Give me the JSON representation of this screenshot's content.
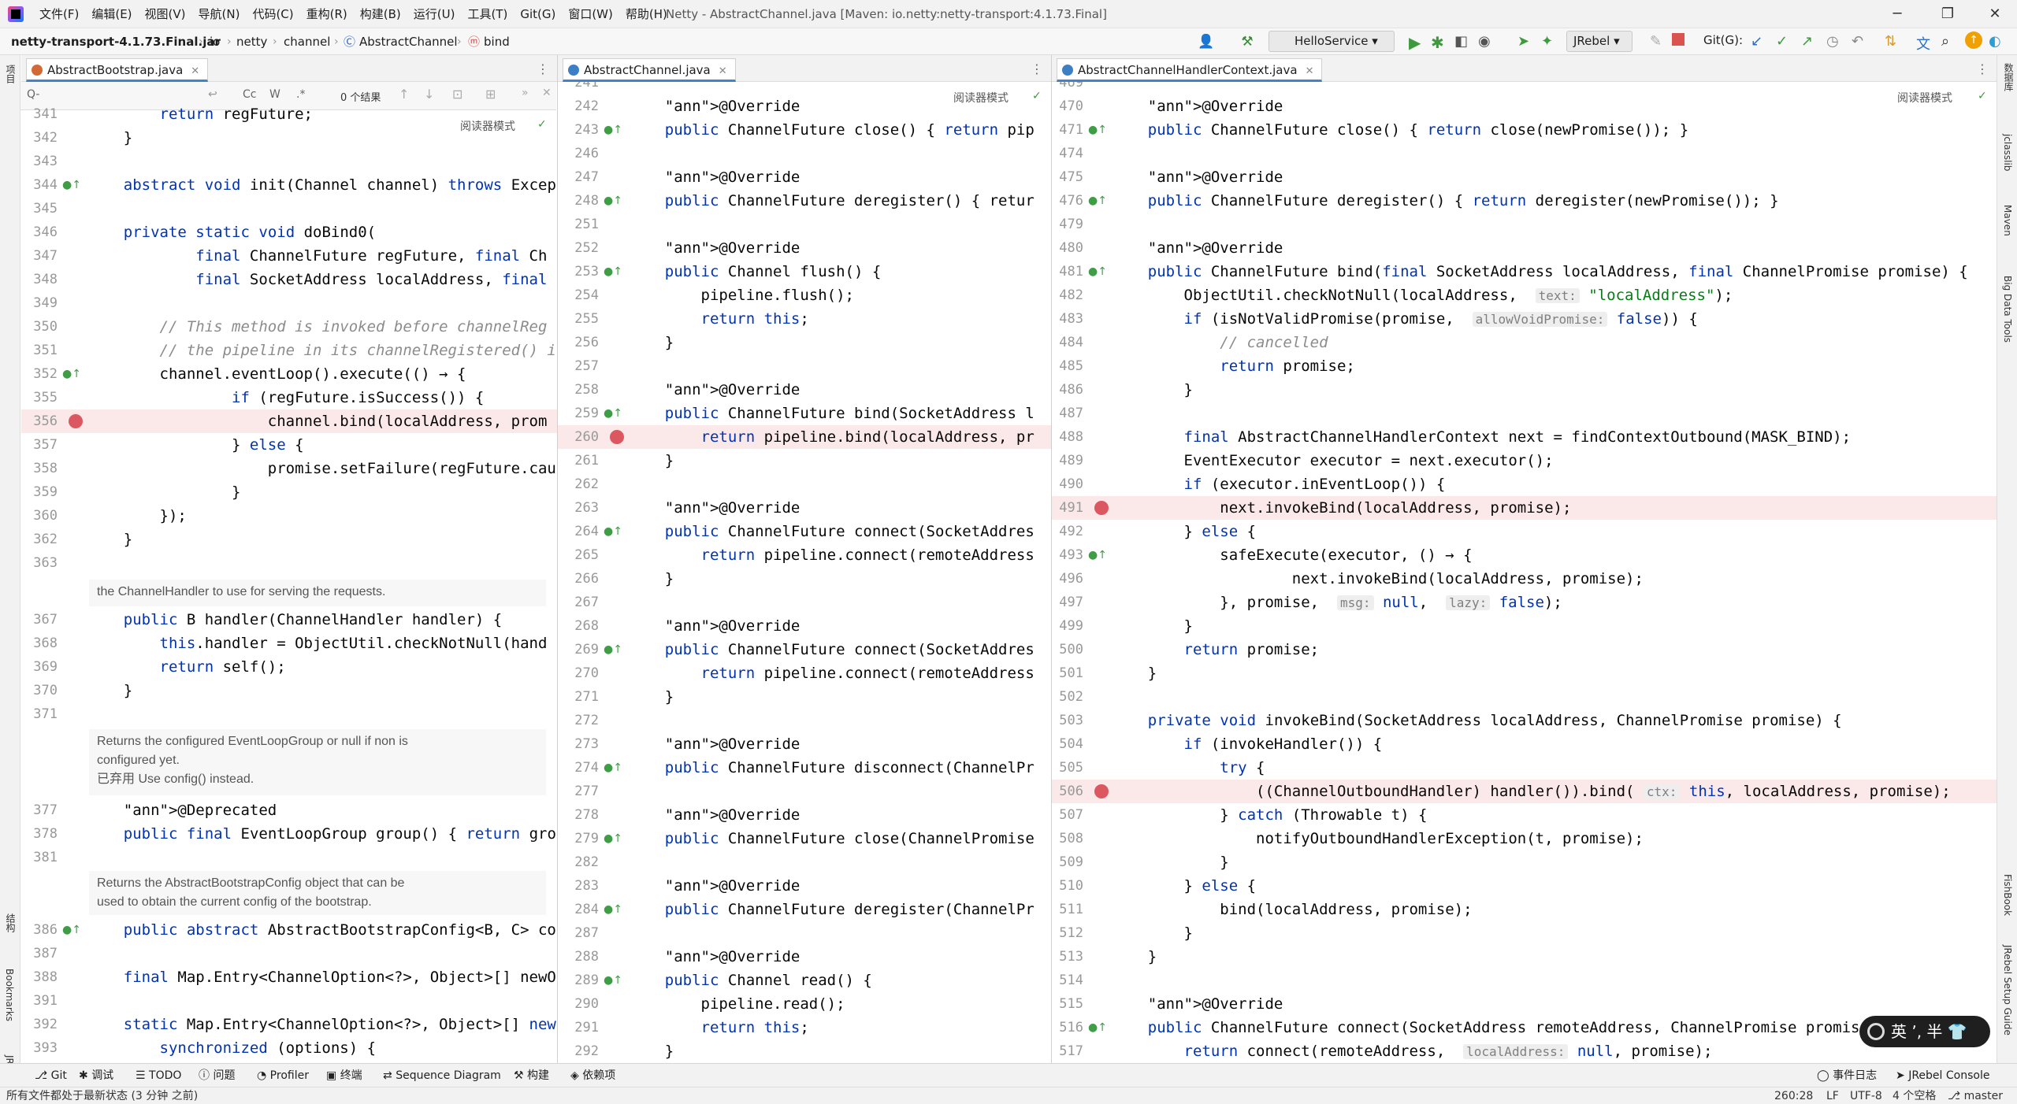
{
  "menubar": {
    "items": [
      "文件(F)",
      "编辑(E)",
      "视图(V)",
      "导航(N)",
      "代码(C)",
      "重构(R)",
      "构建(B)",
      "运行(U)",
      "工具(T)",
      "Git(G)",
      "窗口(W)",
      "帮助(H)"
    ],
    "window_title": "Netty - AbstractChannel.java [Maven: io.netty:netty-transport:4.1.73.Final]"
  },
  "navbar": {
    "crumbs": [
      "netty-transport-4.1.73.Final.jar",
      "io",
      "netty",
      "channel",
      "AbstractChannel",
      "bind"
    ],
    "run_config": "HelloService",
    "jrebel": "JRebel",
    "git_label": "Git(G):"
  },
  "left_strip": {
    "project": "项目",
    "structure": "结构",
    "bookmarks": "Bookmarks",
    "jrebel": "JRebel"
  },
  "right_strip": {
    "a": "数据库",
    "b": "jclasslib",
    "c": "Maven",
    "d": "Big Data Tools",
    "e": "FishBook",
    "f": "JRebel Setup Guide"
  },
  "pane1": {
    "tab": "AbstractBootstrap.java",
    "find": {
      "placeholder": "Q-",
      "cc": "Cc",
      "w": "W",
      "star": ".*",
      "results": "0 个结果"
    },
    "reader_mode": "阅读器模式",
    "lines": [
      {
        "n": "341",
        "t": "        return regFuture;"
      },
      {
        "n": "342",
        "t": "    }"
      },
      {
        "n": "343",
        "t": ""
      },
      {
        "n": "344",
        "t": "    abstract void init(Channel channel) throws Excep"
      },
      {
        "n": "345",
        "t": ""
      },
      {
        "n": "346",
        "t": "    private static void doBind0("
      },
      {
        "n": "347",
        "t": "            final ChannelFuture regFuture, final Ch"
      },
      {
        "n": "348",
        "t": "            final SocketAddress localAddress, final"
      },
      {
        "n": "349",
        "t": ""
      },
      {
        "n": "350",
        "t": "        // This method is invoked before channelReg"
      },
      {
        "n": "351",
        "t": "        // the pipeline in its channelRegistered() i"
      },
      {
        "n": "352",
        "t": "        channel.eventLoop().execute(() → {"
      },
      {
        "n": "355",
        "t": "                if (regFuture.isSuccess()) {"
      },
      {
        "n": "356",
        "t": "                    channel.bind(localAddress, prom"
      },
      {
        "n": "357",
        "t": "                } else {"
      },
      {
        "n": "358",
        "t": "                    promise.setFailure(regFuture.cau"
      },
      {
        "n": "359",
        "t": "                }"
      },
      {
        "n": "360",
        "t": "        });"
      },
      {
        "n": "362",
        "t": "    }"
      },
      {
        "n": "363",
        "t": ""
      }
    ],
    "doc1": "the ChannelHandler to use for serving the requests.",
    "lines2": [
      {
        "n": "367",
        "t": "    public B handler(ChannelHandler handler) {"
      },
      {
        "n": "368",
        "t": "        this.handler = ObjectUtil.checkNotNull(hand"
      },
      {
        "n": "369",
        "t": "        return self();"
      },
      {
        "n": "370",
        "t": "    }"
      },
      {
        "n": "371",
        "t": ""
      }
    ],
    "doc2": [
      "Returns the configured EventLoopGroup or null if non is",
      "configured yet.",
      "已弃用 Use config() instead."
    ],
    "lines3": [
      {
        "n": "377",
        "t": "    @Deprecated"
      },
      {
        "n": "378",
        "t": "    public final EventLoopGroup group() { return gro"
      },
      {
        "n": "381",
        "t": ""
      }
    ],
    "doc3": [
      "Returns the AbstractBootstrapConfig object that can be",
      "used to obtain the current config of the bootstrap."
    ],
    "lines4": [
      {
        "n": "386",
        "t": "    public abstract AbstractBootstrapConfig<B, C> co"
      },
      {
        "n": "387",
        "t": ""
      },
      {
        "n": "388",
        "t": "    final Map.Entry<ChannelOption<?>, Object>[] newO"
      },
      {
        "n": "391",
        "t": ""
      },
      {
        "n": "392",
        "t": "    static Map.Entry<ChannelOption<?>, Object>[] new"
      },
      {
        "n": "393",
        "t": "        synchronized (options) {"
      }
    ]
  },
  "pane2": {
    "tab": "AbstractChannel.java",
    "reader_mode": "阅读器模式",
    "lines": [
      {
        "n": "241",
        "t": ""
      },
      {
        "n": "242",
        "t": "    @Override"
      },
      {
        "n": "243",
        "t": "    public ChannelFuture close() { return pip"
      },
      {
        "n": "246",
        "t": ""
      },
      {
        "n": "247",
        "t": "    @Override"
      },
      {
        "n": "248",
        "t": "    public ChannelFuture deregister() { retur"
      },
      {
        "n": "251",
        "t": ""
      },
      {
        "n": "252",
        "t": "    @Override"
      },
      {
        "n": "253",
        "t": "    public Channel flush() {"
      },
      {
        "n": "254",
        "t": "        pipeline.flush();"
      },
      {
        "n": "255",
        "t": "        return this;"
      },
      {
        "n": "256",
        "t": "    }"
      },
      {
        "n": "257",
        "t": ""
      },
      {
        "n": "258",
        "t": "    @Override"
      },
      {
        "n": "259",
        "t": "    public ChannelFuture bind(SocketAddress l"
      },
      {
        "n": "260",
        "t": "        return pipeline.bind(localAddress, pr"
      },
      {
        "n": "261",
        "t": "    }"
      },
      {
        "n": "262",
        "t": ""
      },
      {
        "n": "263",
        "t": "    @Override"
      },
      {
        "n": "264",
        "t": "    public ChannelFuture connect(SocketAddres"
      },
      {
        "n": "265",
        "t": "        return pipeline.connect(remoteAddress"
      },
      {
        "n": "266",
        "t": "    }"
      },
      {
        "n": "267",
        "t": ""
      },
      {
        "n": "268",
        "t": "    @Override"
      },
      {
        "n": "269",
        "t": "    public ChannelFuture connect(SocketAddres"
      },
      {
        "n": "270",
        "t": "        return pipeline.connect(remoteAddress"
      },
      {
        "n": "271",
        "t": "    }"
      },
      {
        "n": "272",
        "t": ""
      },
      {
        "n": "273",
        "t": "    @Override"
      },
      {
        "n": "274",
        "t": "    public ChannelFuture disconnect(ChannelPr"
      },
      {
        "n": "277",
        "t": ""
      },
      {
        "n": "278",
        "t": "    @Override"
      },
      {
        "n": "279",
        "t": "    public ChannelFuture close(ChannelPromise"
      },
      {
        "n": "282",
        "t": ""
      },
      {
        "n": "283",
        "t": "    @Override"
      },
      {
        "n": "284",
        "t": "    public ChannelFuture deregister(ChannelPr"
      },
      {
        "n": "287",
        "t": ""
      },
      {
        "n": "288",
        "t": "    @Override"
      },
      {
        "n": "289",
        "t": "    public Channel read() {"
      },
      {
        "n": "290",
        "t": "        pipeline.read();"
      },
      {
        "n": "291",
        "t": "        return this;"
      },
      {
        "n": "292",
        "t": "    }"
      }
    ]
  },
  "pane3": {
    "tab": "AbstractChannelHandlerContext.java",
    "reader_mode": "阅读器模式",
    "lines": [
      {
        "n": "469",
        "t": ""
      },
      {
        "n": "470",
        "t": "    @Override"
      },
      {
        "n": "471",
        "t": "    public ChannelFuture close() { return close(newPromise()); }"
      },
      {
        "n": "474",
        "t": ""
      },
      {
        "n": "475",
        "t": "    @Override"
      },
      {
        "n": "476",
        "t": "    public ChannelFuture deregister() { return deregister(newPromise()); }"
      },
      {
        "n": "479",
        "t": ""
      },
      {
        "n": "480",
        "t": "    @Override"
      },
      {
        "n": "481",
        "t": "    public ChannelFuture bind(final SocketAddress localAddress, final ChannelPromise promise) {"
      },
      {
        "n": "482",
        "t": "        ObjectUtil.checkNotNull(localAddress,  text: \"localAddress\");"
      },
      {
        "n": "483",
        "t": "        if (isNotValidPromise(promise,  allowVoidPromise: false)) {"
      },
      {
        "n": "484",
        "t": "            // cancelled"
      },
      {
        "n": "485",
        "t": "            return promise;"
      },
      {
        "n": "486",
        "t": "        }"
      },
      {
        "n": "487",
        "t": ""
      },
      {
        "n": "488",
        "t": "        final AbstractChannelHandlerContext next = findContextOutbound(MASK_BIND);"
      },
      {
        "n": "489",
        "t": "        EventExecutor executor = next.executor();"
      },
      {
        "n": "490",
        "t": "        if (executor.inEventLoop()) {"
      },
      {
        "n": "491",
        "t": "            next.invokeBind(localAddress, promise);"
      },
      {
        "n": "492",
        "t": "        } else {"
      },
      {
        "n": "493",
        "t": "            safeExecute(executor, () → {"
      },
      {
        "n": "496",
        "t": "                    next.invokeBind(localAddress, promise);"
      },
      {
        "n": "497",
        "t": "            }, promise,  msg: null,  lazy: false);"
      },
      {
        "n": "499",
        "t": "        }"
      },
      {
        "n": "500",
        "t": "        return promise;"
      },
      {
        "n": "501",
        "t": "    }"
      },
      {
        "n": "502",
        "t": ""
      },
      {
        "n": "503",
        "t": "    private void invokeBind(SocketAddress localAddress, ChannelPromise promise) {"
      },
      {
        "n": "504",
        "t": "        if (invokeHandler()) {"
      },
      {
        "n": "505",
        "t": "            try {"
      },
      {
        "n": "506",
        "t": "                ((ChannelOutboundHandler) handler()).bind( ctx: this, localAddress, promise);"
      },
      {
        "n": "507",
        "t": "            } catch (Throwable t) {"
      },
      {
        "n": "508",
        "t": "                notifyOutboundHandlerException(t, promise);"
      },
      {
        "n": "509",
        "t": "            }"
      },
      {
        "n": "510",
        "t": "        } else {"
      },
      {
        "n": "511",
        "t": "            bind(localAddress, promise);"
      },
      {
        "n": "512",
        "t": "        }"
      },
      {
        "n": "513",
        "t": "    }"
      },
      {
        "n": "514",
        "t": ""
      },
      {
        "n": "515",
        "t": "    @Override"
      },
      {
        "n": "516",
        "t": "    public ChannelFuture connect(SocketAddress remoteAddress, ChannelPromise promis"
      },
      {
        "n": "517",
        "t": "        return connect(remoteAddress,  localAddress: null, promise);"
      }
    ]
  },
  "ime": "英 ʼ, 半",
  "toolwindows": [
    "Git",
    "调试",
    "TODO",
    "问题",
    "Profiler",
    "终端",
    "Sequence Diagram",
    "构建",
    "依赖项"
  ],
  "toolwindows_right": [
    "事件日志",
    "JRebel Console"
  ],
  "status": {
    "message": "所有文件都处于最新状态 (3 分钟 之前)",
    "position": "260:28",
    "line_sep": "LF",
    "encoding": "UTF-8",
    "indent": "4 个空格",
    "branch": "master"
  }
}
